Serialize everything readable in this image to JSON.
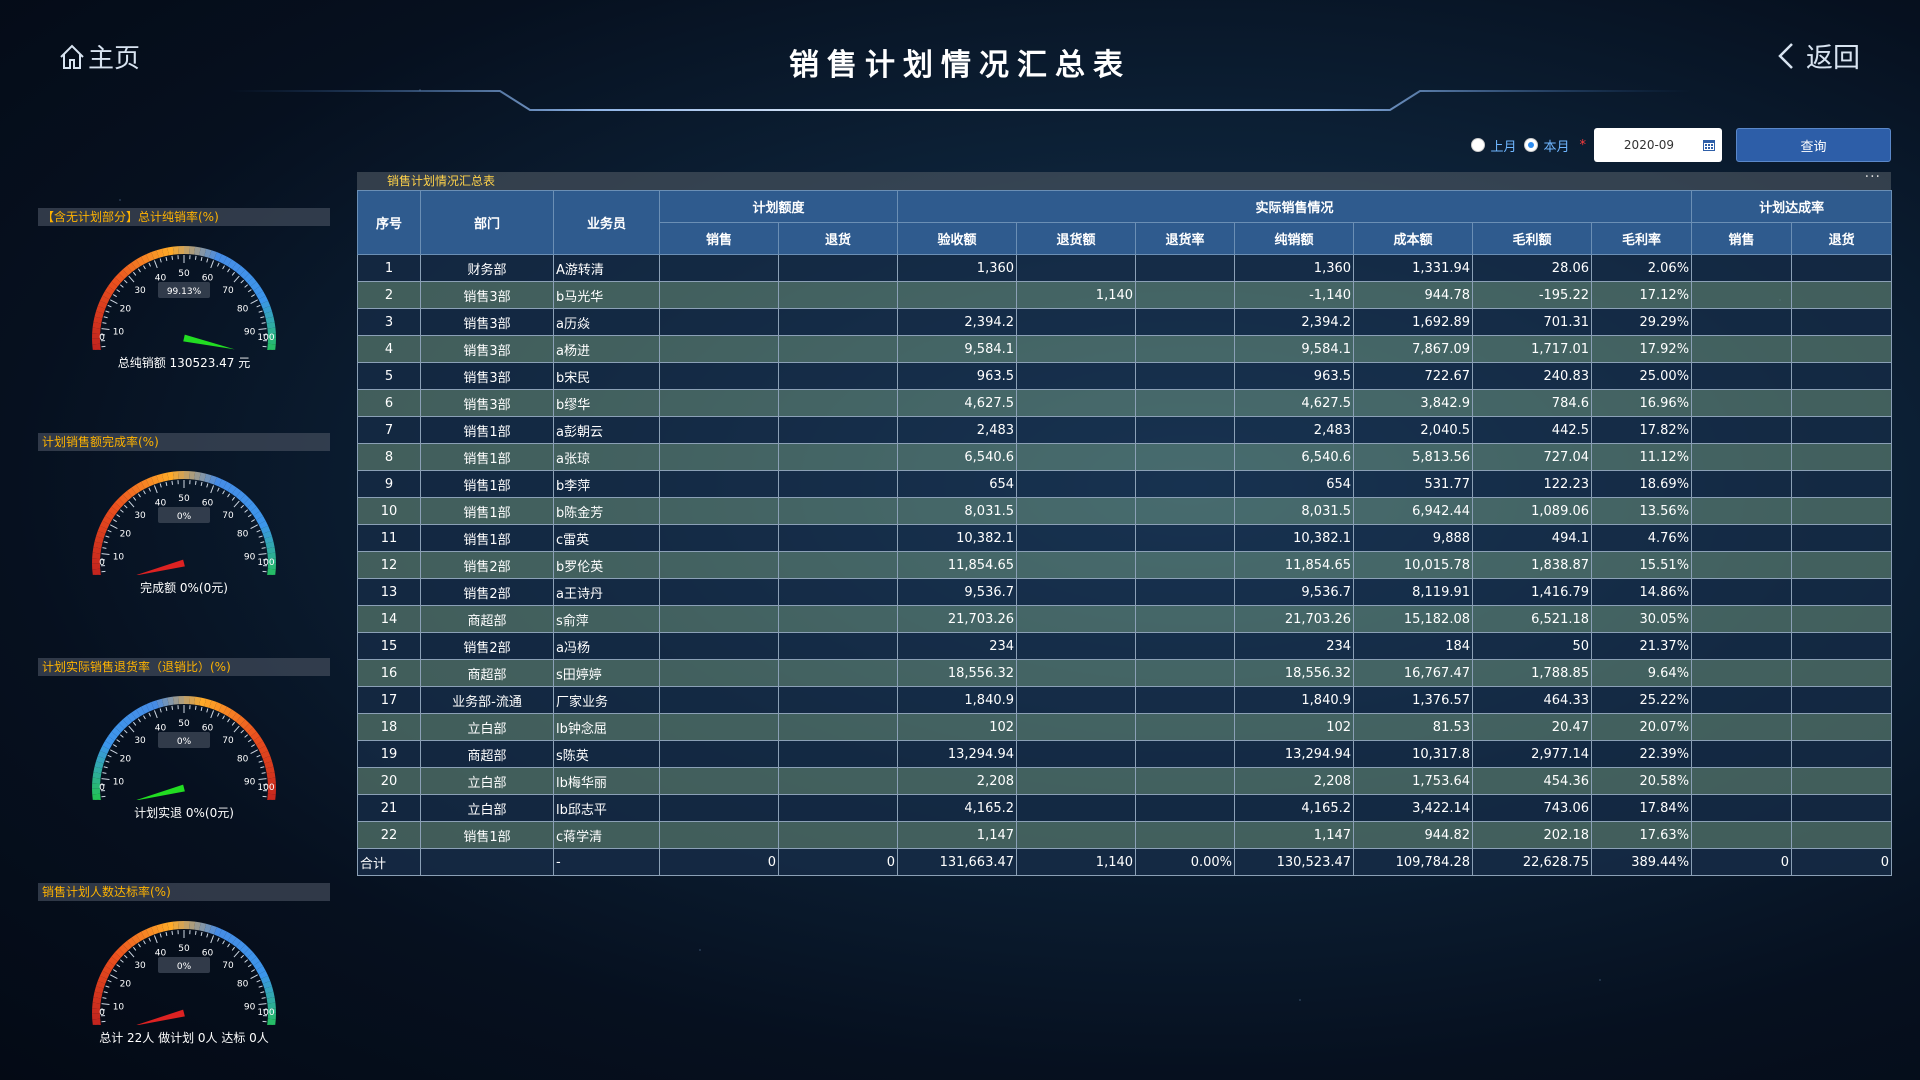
{
  "header": {
    "home_label": "主页",
    "title": "销售计划情况汇总表",
    "back_label": "返回"
  },
  "controls": {
    "radio_last_month": "上月",
    "radio_this_month": "本月",
    "selected": "本月",
    "month_value": "2020-09",
    "query_label": "查询"
  },
  "colors": {
    "background": "#0a1a2e",
    "header_blue": "#2f5b8e",
    "panel_title": "#ffb300",
    "table_title": "#ffd24a",
    "query_button": "#2d5ea8"
  },
  "panels": [
    {
      "title": "【含无计划部分】总计纯销率(%)",
      "gauge_value": 99.13,
      "gauge_display": "99.13%",
      "needle_color": "#22dd22",
      "scale": "red-to-green",
      "footer": "总纯销额 130523.47 元"
    },
    {
      "title": "计划销售额完成率(%)",
      "gauge_value": 0,
      "gauge_display": "0%",
      "needle_color": "#dd2222",
      "scale": "red-to-green",
      "footer": "完成额 0%(0元)"
    },
    {
      "title": "计划实际销售退货率（退销比）(%)",
      "gauge_value": 0,
      "gauge_display": "0%",
      "needle_color": "#22dd22",
      "scale": "green-to-red",
      "footer": "计划实退 0%(0元)"
    },
    {
      "title": "销售计划人数达标率(%)",
      "gauge_value": 0,
      "gauge_display": "0%",
      "needle_color": "#dd2222",
      "scale": "red-to-green",
      "footer": "总计 22人 做计划 0人 达标 0人"
    }
  ],
  "gauge_ticks": [
    "0",
    "10",
    "20",
    "30",
    "40",
    "50",
    "60",
    "70",
    "80",
    "90",
    "100"
  ],
  "table": {
    "title": "销售计划情况汇总表",
    "more": "···",
    "group_headers": {
      "seq": "序号",
      "dept": "部门",
      "staff": "业务员",
      "plan": "计划额度",
      "actual": "实际销售情况",
      "rate": "计划达成率"
    },
    "sub_headers": [
      "销售",
      "退货",
      "验收额",
      "退货额",
      "退货率",
      "纯销额",
      "成本额",
      "毛利额",
      "毛利率",
      "销售",
      "退货"
    ],
    "rows": [
      [
        "1",
        "财务部",
        "A游转清",
        "",
        "",
        "1,360",
        "",
        "",
        "1,360",
        "1,331.94",
        "28.06",
        "2.06%",
        "",
        ""
      ],
      [
        "2",
        "销售3部",
        "b马光华",
        "",
        "",
        "",
        "1,140",
        "",
        "-1,140",
        "944.78",
        "-195.22",
        "17.12%",
        "",
        ""
      ],
      [
        "3",
        "销售3部",
        "a历焱",
        "",
        "",
        "2,394.2",
        "",
        "",
        "2,394.2",
        "1,692.89",
        "701.31",
        "29.29%",
        "",
        ""
      ],
      [
        "4",
        "销售3部",
        "a杨进",
        "",
        "",
        "9,584.1",
        "",
        "",
        "9,584.1",
        "7,867.09",
        "1,717.01",
        "17.92%",
        "",
        ""
      ],
      [
        "5",
        "销售3部",
        "b宋民",
        "",
        "",
        "963.5",
        "",
        "",
        "963.5",
        "722.67",
        "240.83",
        "25.00%",
        "",
        ""
      ],
      [
        "6",
        "销售3部",
        "b缪华",
        "",
        "",
        "4,627.5",
        "",
        "",
        "4,627.5",
        "3,842.9",
        "784.6",
        "16.96%",
        "",
        ""
      ],
      [
        "7",
        "销售1部",
        "a彭朝云",
        "",
        "",
        "2,483",
        "",
        "",
        "2,483",
        "2,040.5",
        "442.5",
        "17.82%",
        "",
        ""
      ],
      [
        "8",
        "销售1部",
        "a张琼",
        "",
        "",
        "6,540.6",
        "",
        "",
        "6,540.6",
        "5,813.56",
        "727.04",
        "11.12%",
        "",
        ""
      ],
      [
        "9",
        "销售1部",
        "b李萍",
        "",
        "",
        "654",
        "",
        "",
        "654",
        "531.77",
        "122.23",
        "18.69%",
        "",
        ""
      ],
      [
        "10",
        "销售1部",
        "b陈金芳",
        "",
        "",
        "8,031.5",
        "",
        "",
        "8,031.5",
        "6,942.44",
        "1,089.06",
        "13.56%",
        "",
        ""
      ],
      [
        "11",
        "销售1部",
        "c雷英",
        "",
        "",
        "10,382.1",
        "",
        "",
        "10,382.1",
        "9,888",
        "494.1",
        "4.76%",
        "",
        ""
      ],
      [
        "12",
        "销售2部",
        "b罗伦英",
        "",
        "",
        "11,854.65",
        "",
        "",
        "11,854.65",
        "10,015.78",
        "1,838.87",
        "15.51%",
        "",
        ""
      ],
      [
        "13",
        "销售2部",
        "a王诗丹",
        "",
        "",
        "9,536.7",
        "",
        "",
        "9,536.7",
        "8,119.91",
        "1,416.79",
        "14.86%",
        "",
        ""
      ],
      [
        "14",
        "商超部",
        "s俞萍",
        "",
        "",
        "21,703.26",
        "",
        "",
        "21,703.26",
        "15,182.08",
        "6,521.18",
        "30.05%",
        "",
        ""
      ],
      [
        "15",
        "销售2部",
        "a冯杨",
        "",
        "",
        "234",
        "",
        "",
        "234",
        "184",
        "50",
        "21.37%",
        "",
        ""
      ],
      [
        "16",
        "商超部",
        "s田婷婷",
        "",
        "",
        "18,556.32",
        "",
        "",
        "18,556.32",
        "16,767.47",
        "1,788.85",
        "9.64%",
        "",
        ""
      ],
      [
        "17",
        "业务部-流通",
        "厂家业务",
        "",
        "",
        "1,840.9",
        "",
        "",
        "1,840.9",
        "1,376.57",
        "464.33",
        "25.22%",
        "",
        ""
      ],
      [
        "18",
        "立白部",
        "lb钟念屈",
        "",
        "",
        "102",
        "",
        "",
        "102",
        "81.53",
        "20.47",
        "20.07%",
        "",
        ""
      ],
      [
        "19",
        "商超部",
        "s陈英",
        "",
        "",
        "13,294.94",
        "",
        "",
        "13,294.94",
        "10,317.8",
        "2,977.14",
        "22.39%",
        "",
        ""
      ],
      [
        "20",
        "立白部",
        "lb梅华丽",
        "",
        "",
        "2,208",
        "",
        "",
        "2,208",
        "1,753.64",
        "454.36",
        "20.58%",
        "",
        ""
      ],
      [
        "21",
        "立白部",
        "lb邱志平",
        "",
        "",
        "4,165.2",
        "",
        "",
        "4,165.2",
        "3,422.14",
        "743.06",
        "17.84%",
        "",
        ""
      ],
      [
        "22",
        "销售1部",
        "c蒋学清",
        "",
        "",
        "1,147",
        "",
        "",
        "1,147",
        "944.82",
        "202.18",
        "17.63%",
        "",
        ""
      ]
    ],
    "total": [
      "合计",
      "",
      "-",
      "0",
      "0",
      "131,663.47",
      "1,140",
      "0.00%",
      "130,523.47",
      "109,784.28",
      "22,628.75",
      "389.44%",
      "0",
      "0"
    ]
  }
}
